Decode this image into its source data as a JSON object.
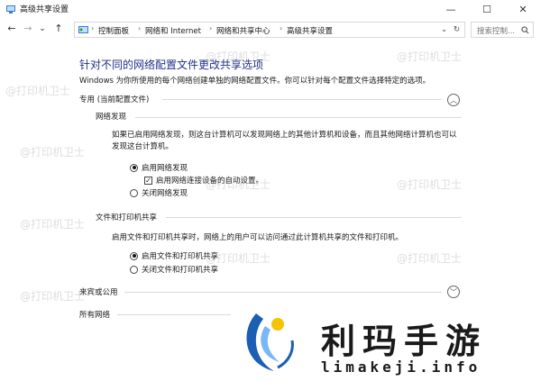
{
  "window": {
    "title": "高级共享设置",
    "minimize": "—",
    "maximize": "☐",
    "close": "✕"
  },
  "nav": {
    "back": "←",
    "forward": "→",
    "dropdown": "⌄",
    "up": "↑"
  },
  "address": {
    "crumbs": [
      "控制面板",
      "网络和 Internet",
      "网络和共享中心",
      "高级共享设置"
    ],
    "separator": "›",
    "dropdown": "⌄",
    "refresh": "↻"
  },
  "search": {
    "placeholder": "搜索控制..."
  },
  "main": {
    "heading": "针对不同的网络配置文件更改共享选项",
    "description": "Windows 为你所使用的每个网络创建单独的网络配置文件。你可以针对每个配置文件选择特定的选项。",
    "private_profile": {
      "title": "专用 (当前配置文件)",
      "network_discovery": {
        "title": "网络发现",
        "description": "如果已启用网络发现，则这台计算机可以发现网络上的其他计算机和设备，而且其他网络计算机也可以发现这台计算机。",
        "option_on": "启用网络发现",
        "auto_setup": "启用网络连接设备的自动设置。",
        "option_off": "关闭网络发现"
      },
      "file_printer_sharing": {
        "title": "文件和打印机共享",
        "description": "启用文件和打印机共享时，网络上的用户可以访问通过此计算机共享的文件和打印机。",
        "option_on": "启用文件和打印机共享",
        "option_off": "关闭文件和打印机共享"
      }
    },
    "guest_profile": {
      "title": "来宾或公用"
    },
    "all_networks": {
      "title": "所有网络"
    }
  },
  "watermark": "@打印机卫士",
  "brand": {
    "name_cn": "利玛手游",
    "domain": "limakeji.info"
  },
  "colors": {
    "heading": "#1e3287",
    "logo_blue": "#1a5fb4",
    "logo_yellow": "#f5c400"
  }
}
